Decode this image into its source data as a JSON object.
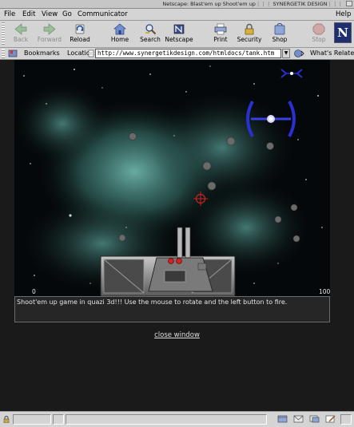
{
  "window": {
    "title": "Netscape: Blast'em up Shoot'em up⋮⋮⋮ SYNERGETIK DESIGN⋮⋮⋮"
  },
  "menubar": {
    "items": [
      "File",
      "Edit",
      "View",
      "Go",
      "Communicator"
    ],
    "help": "Help"
  },
  "toolbar": {
    "buttons": [
      {
        "label": "Back",
        "icon": "back-arrow-icon",
        "enabled": false
      },
      {
        "label": "Forward",
        "icon": "forward-arrow-icon",
        "enabled": false
      },
      {
        "label": "Reload",
        "icon": "reload-icon",
        "enabled": true
      },
      {
        "label": "Home",
        "icon": "home-icon",
        "enabled": true
      },
      {
        "label": "Search",
        "icon": "search-icon",
        "enabled": true
      },
      {
        "label": "Netscape",
        "icon": "netscape-icon",
        "enabled": true
      },
      {
        "label": "Print",
        "icon": "print-icon",
        "enabled": true
      },
      {
        "label": "Security",
        "icon": "security-lock-icon",
        "enabled": true
      },
      {
        "label": "Shop",
        "icon": "shop-icon",
        "enabled": true
      },
      {
        "label": "Stop",
        "icon": "stop-icon",
        "enabled": false
      }
    ],
    "logo": "N"
  },
  "location_bar": {
    "bookmarks_label": "Bookmarks",
    "location_label": "Location:",
    "url": "http://www.synergetikdesign.com/htmldocs/tank.htm",
    "dropdown": "▼",
    "related_label": "What's Related"
  },
  "page": {
    "game": {
      "score_left": "0",
      "score_right": "100"
    },
    "caption": "Shoot'em up game in quazi 3d!!! Use the mouse to rotate and the left button to fire.",
    "close_link": "close window"
  },
  "colors": {
    "chrome": "#d4d4d4",
    "page_background": "#1a1a1a",
    "nebula": "#3f7f76",
    "enemy_ship": "#2a2fd0",
    "crosshair": "#cc2222",
    "netscape_logo_bg": "#1d2f6e"
  },
  "statusbar": {
    "icons": [
      "security-lock-icon",
      "navigator-icon",
      "mail-icon",
      "newsgroups-icon",
      "composer-icon"
    ]
  }
}
